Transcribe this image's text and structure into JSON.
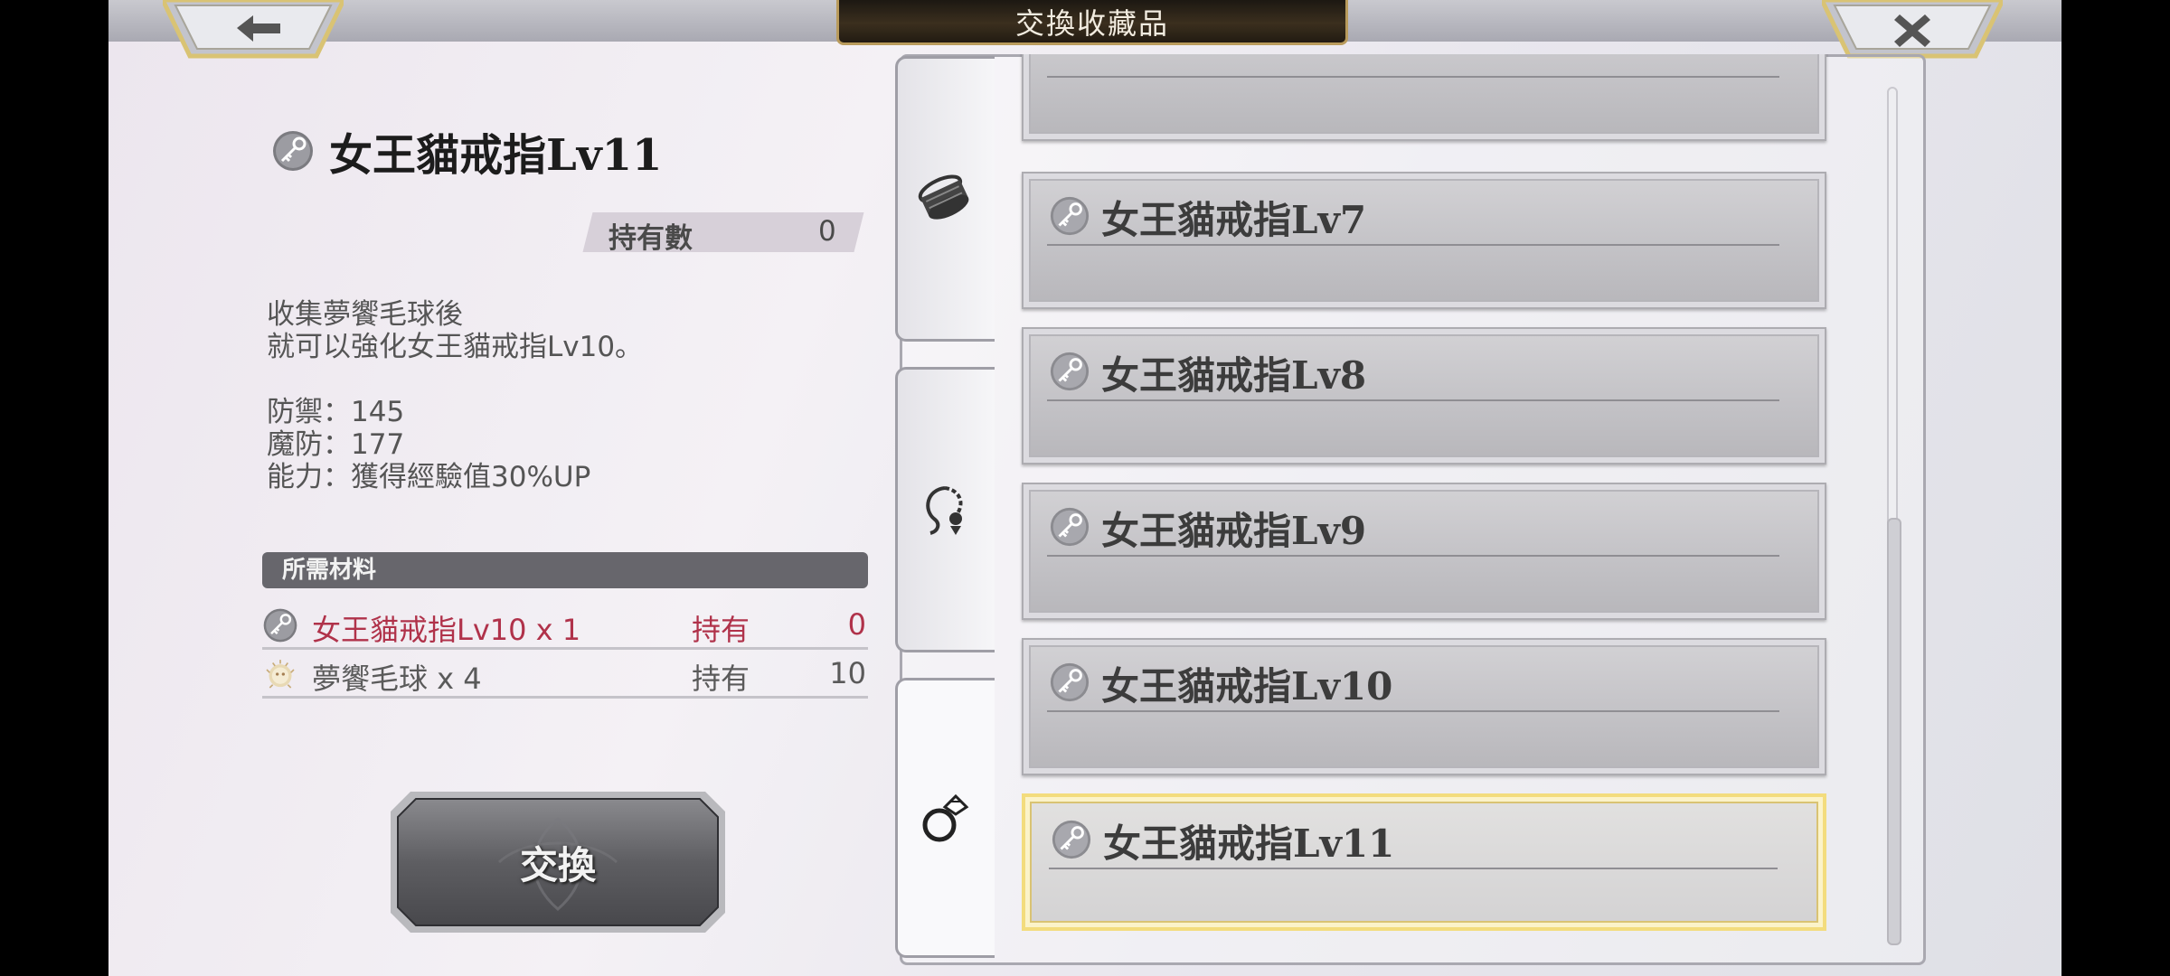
{
  "header": {
    "title": "交換收藏品",
    "back_icon": "back-arrow-icon",
    "close_icon": "close-icon"
  },
  "item": {
    "name": "女王貓戒指Lv11",
    "icon": "key-icon",
    "owned_label": "持有數",
    "owned_value": "0",
    "description_lines": [
      "收集夢饗毛球後",
      "就可以強化女王貓戒指Lv10。"
    ],
    "stats": [
      "防禦：145",
      "魔防：177",
      "能力：獲得經驗值30%UP"
    ]
  },
  "materials": {
    "header": "所需材料",
    "rows": [
      {
        "name": "女王貓戒指Lv10 x 1",
        "owned_label": "持有",
        "owned": "0",
        "icon": "key-icon",
        "color": "#b0324a"
      },
      {
        "name": "夢饗毛球 x 4",
        "owned_label": "持有",
        "owned": "10",
        "icon": "fur-ball-icon",
        "color": "#5a5a5a"
      }
    ]
  },
  "exchange_button": {
    "label": "交換"
  },
  "tabs": [
    {
      "icon": "bracelet-icon"
    },
    {
      "icon": "chain-pendant-icon"
    },
    {
      "icon": "ring-icon",
      "selected": true
    }
  ],
  "list": {
    "items": [
      {
        "name": "",
        "partial": true
      },
      {
        "name": "女王貓戒指Lv7"
      },
      {
        "name": "女王貓戒指Lv8"
      },
      {
        "name": "女王貓戒指Lv9"
      },
      {
        "name": "女王貓戒指Lv10"
      },
      {
        "name": "女王貓戒指Lv11",
        "selected": true
      }
    ]
  },
  "colors": {
    "accent_gold": "#f3dc7d",
    "required_red": "#b0324a",
    "title_plate": "#2a2218"
  }
}
